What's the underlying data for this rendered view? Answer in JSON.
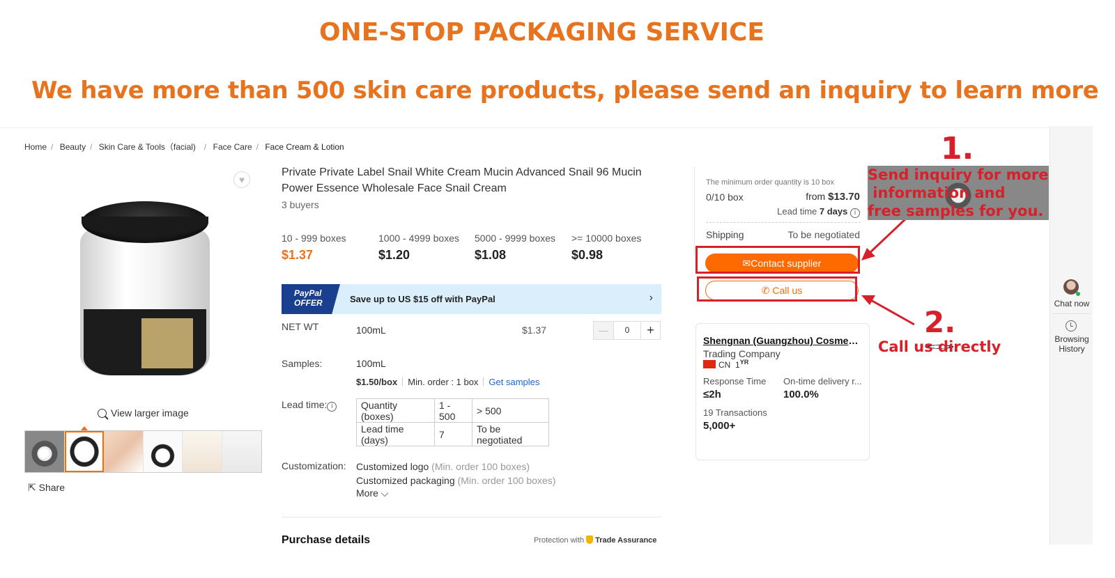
{
  "banner": {
    "title": "ONE-STOP PACKAGING SERVICE",
    "subtitle": "We have more than 500 skin care products, please send an inquiry to learn more"
  },
  "breadcrumb": [
    "Home",
    "Beauty",
    "Skin Care & Tools（facial)",
    "Face Care",
    "Face Cream & Lotion"
  ],
  "gallery": {
    "view_larger": "View larger image",
    "share": "Share"
  },
  "product": {
    "title": "Private Private Label Snail White Cream Mucin Advanced Snail 96 Mucin Power Essence Wholesale Face Snail Cream",
    "buyers": "3 buyers",
    "tiers": [
      {
        "range": "10 - 999 boxes",
        "price": "$1.37"
      },
      {
        "range": "1000 - 4999 boxes",
        "price": "$1.20"
      },
      {
        "range": "5000 - 9999 boxes",
        "price": "$1.08"
      },
      {
        "range": ">= 10000 boxes",
        "price": "$0.98"
      }
    ],
    "paypal": {
      "badge_line1": "PayPal",
      "badge_line2": "OFFER",
      "text": "Save up to US $15 off with PayPal",
      "chevron": "›"
    },
    "net_wt": {
      "label": "NET WT",
      "value": "100mL",
      "price": "$1.37",
      "qty": "0",
      "minus": "—",
      "plus": "+"
    },
    "samples": {
      "label": "Samples:",
      "value": "100mL",
      "price": "$1.50/box",
      "min_order": "Min. order : 1 box",
      "link": "Get samples"
    },
    "lead_time": {
      "label": "Lead time:",
      "info": "i",
      "rows": [
        [
          "Quantity (boxes)",
          "1 - 500",
          "> 500"
        ],
        [
          "Lead time (days)",
          "7",
          "To be negotiated"
        ]
      ]
    },
    "customization": {
      "label": "Customization:",
      "items": [
        {
          "name": "Customized logo",
          "note": "(Min. order 100 boxes)"
        },
        {
          "name": "Customized packaging",
          "note": "(Min. order 100 boxes)"
        }
      ],
      "more": "More ⌵"
    },
    "purchase_details": "Purchase details",
    "protection": {
      "prefix": "Protection with",
      "brand": "Trade Assurance"
    }
  },
  "order": {
    "moq": "The minimum order quantity is 10 box",
    "count": "0/10 box",
    "from_label": "from",
    "from_price": "$13.70",
    "lead_prefix": "Lead time",
    "lead_value": "7 days",
    "shipping_label": "Shipping",
    "shipping_value": "To be negotiated",
    "contact": "Contact supplier",
    "call": "Call us"
  },
  "supplier": {
    "name": "Shengnan (Guangzhou) Cosmetic Co., Ltd.",
    "type": "Trading Company",
    "country": "CN",
    "years": "1",
    "years_suffix": "YR",
    "response_label": "Response Time",
    "response_value": "≤2h",
    "ontime_label": "On-time delivery r...",
    "ontime_value": "100.0%",
    "transactions_label": "19 Transactions",
    "transactions_value": "5,000+"
  },
  "annotations": {
    "n1": "1.",
    "t1_l1": "Send inquiry for more",
    "t1_l2": " information and",
    "t1_l3": "free samples for you.",
    "n2": "2.",
    "t2": "Call us directly"
  },
  "rail": {
    "chat": "Chat now",
    "browsing_l1": "Browsing",
    "browsing_l2": "History"
  },
  "colors": {
    "accent": "#ff6a00",
    "banner": "#e8731f",
    "annotation": "#d8202a",
    "link": "#1a66c8"
  }
}
